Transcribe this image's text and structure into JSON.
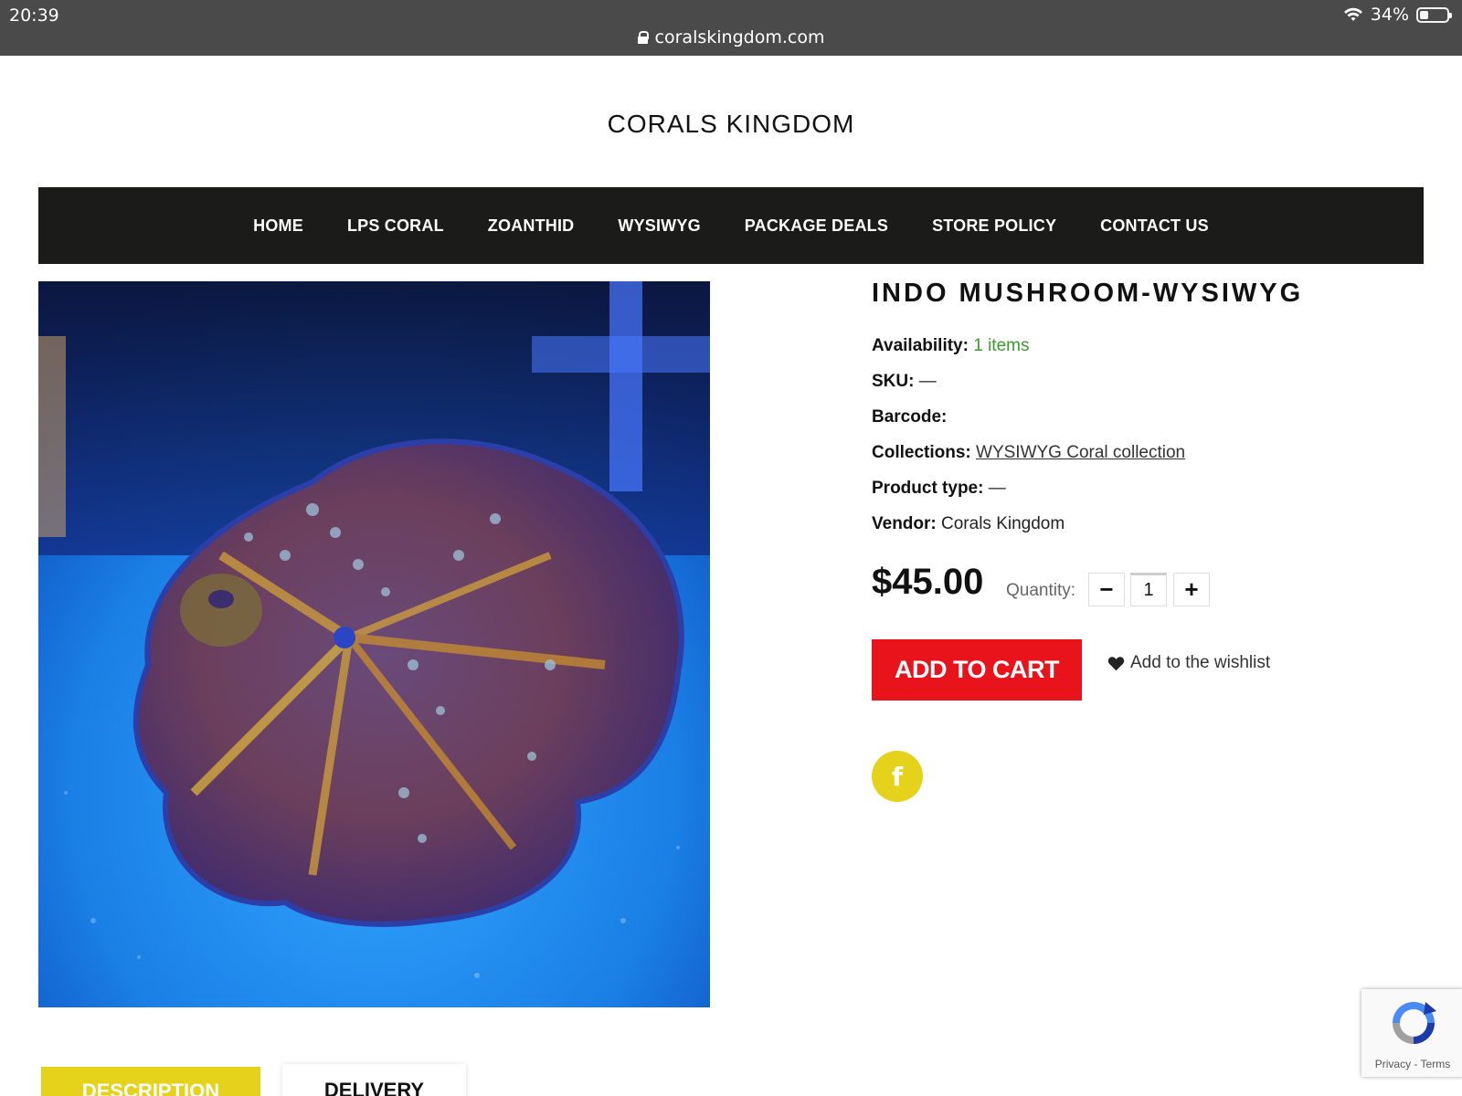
{
  "status_bar": {
    "time": "20:39",
    "battery": "34%",
    "url": "coralskingdom.com"
  },
  "site": {
    "logo": "CORALS KINGDOM"
  },
  "nav": {
    "items": [
      {
        "label": "HOME"
      },
      {
        "label": "LPS CORAL"
      },
      {
        "label": "ZOANTHID"
      },
      {
        "label": "WYSIWYG"
      },
      {
        "label": "PACKAGE DEALS"
      },
      {
        "label": "STORE POLICY"
      },
      {
        "label": "CONTACT US"
      }
    ]
  },
  "product": {
    "title": "INDO MUSHROOM-WYSIWYG",
    "availability_label": "Availability:",
    "availability_value": "1 items",
    "sku_label": "SKU:",
    "sku_value": "—",
    "barcode_label": "Barcode:",
    "collections_label": "Collections:",
    "collections_value": "WYSIWYG Coral collection",
    "product_type_label": "Product type:",
    "product_type_value": "—",
    "vendor_label": "Vendor:",
    "vendor_value": "Corals Kingdom",
    "price": "$45.00",
    "quantity_label": "Quantity:",
    "quantity_value": "1",
    "qty_minus": "−",
    "qty_plus": "+",
    "add_to_cart": "ADD TO CART",
    "wishlist": "Add to the wishlist",
    "facebook": "f"
  },
  "tabs": {
    "description": "DESCRIPTION",
    "delivery": "DELIVERY"
  },
  "recaptcha": {
    "text": "Privacy - Terms"
  },
  "colors": {
    "nav_bg": "#1b1b1a",
    "accent_yellow": "#e5d21a",
    "cart_red": "#e8131b",
    "availability_green": "#3a9a2b"
  },
  "icons": [
    "wifi-icon",
    "battery-icon",
    "lock-icon",
    "heart-icon",
    "facebook-icon",
    "recaptcha-icon"
  ]
}
